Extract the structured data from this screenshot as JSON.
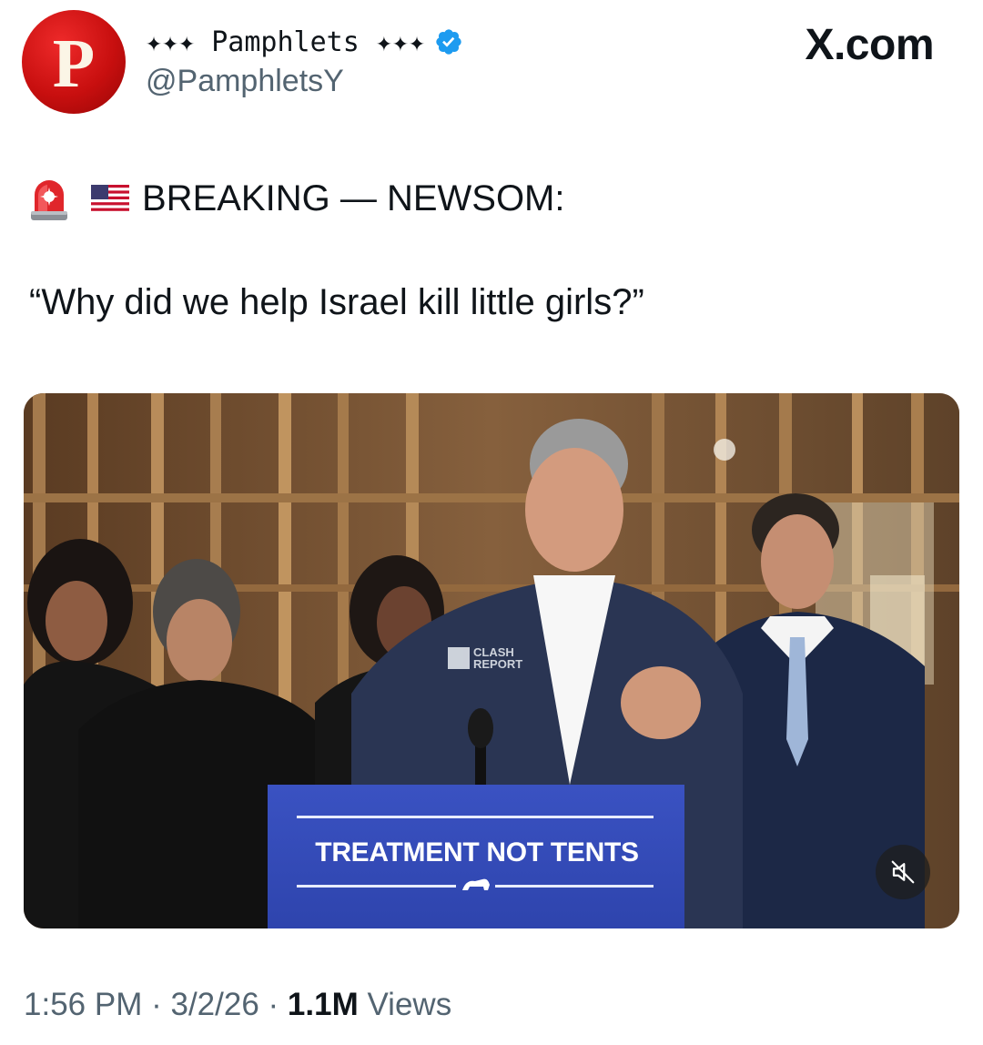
{
  "author": {
    "avatar_letter": "P",
    "display_name": "✦✦✦ Pamphlets ✦✦✦",
    "handle": "@PamphletsY",
    "verified_icon": "verified-badge-icon"
  },
  "brand": "X.com",
  "tweet": {
    "headline_icons": [
      "rotating-light-icon",
      "us-flag-icon"
    ],
    "headline": "BREAKING — NEWSOM:",
    "quote": "“Why did we help Israel kill little girls?”"
  },
  "media": {
    "watermark": [
      "CLASH",
      "REPORT"
    ],
    "podium_text": "TREATMENT NOT TENTS",
    "mute_icon": "muted-speaker-icon"
  },
  "meta": {
    "time": "1:56 PM",
    "date": "3/2/26",
    "views_count": "1.1M",
    "views_label": "Views",
    "separator": "·"
  },
  "colors": {
    "accent_blue": "#1d9bf0",
    "avatar_red": "#c80f0f",
    "podium_blue": "#3349b5",
    "secondary_text": "#536471"
  }
}
